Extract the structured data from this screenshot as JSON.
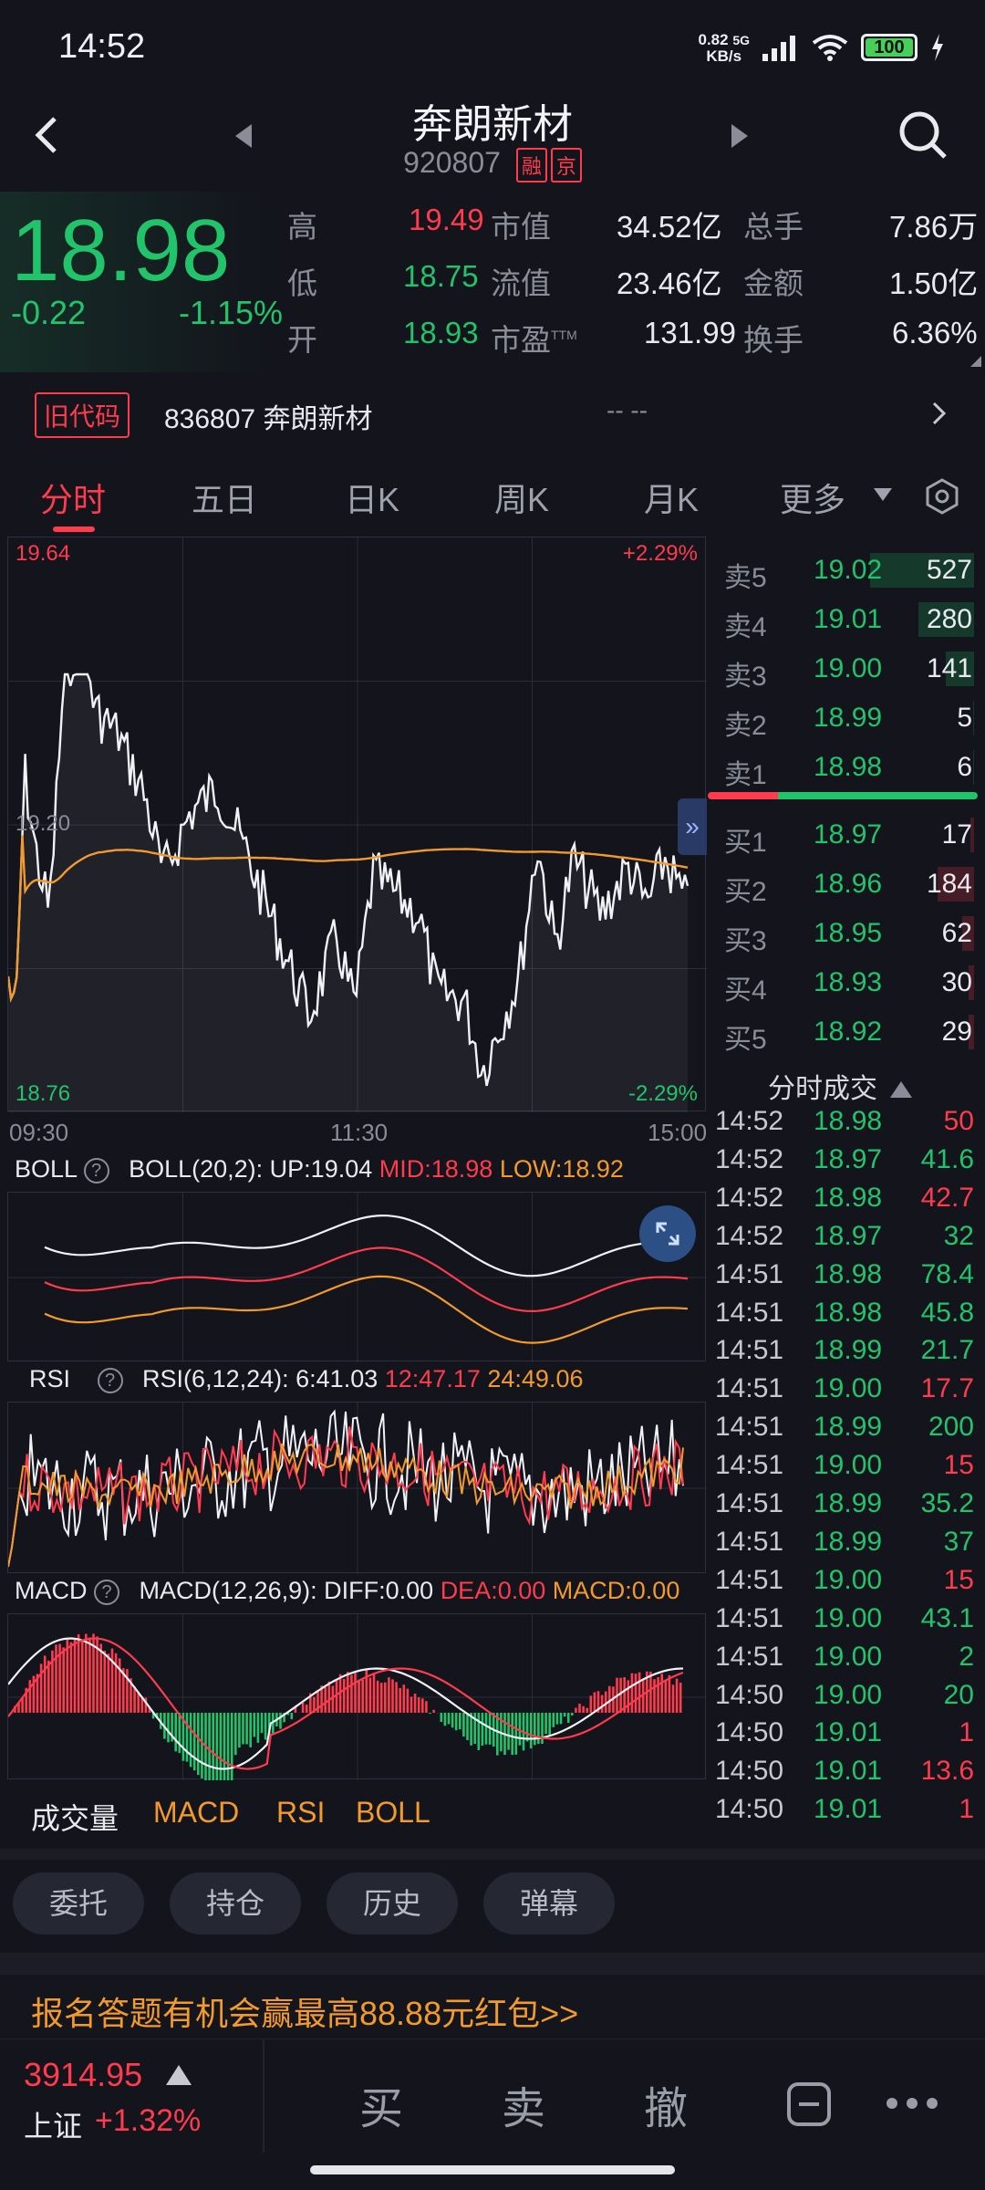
{
  "status": {
    "time": "14:52",
    "netspeed_value": "0.82",
    "netspeed_unit": "KB/s",
    "network": "5G",
    "battery": "100"
  },
  "header": {
    "title": "奔朗新材",
    "code": "920807",
    "tag1": "融",
    "tag2": "京"
  },
  "quote": {
    "price": "18.98",
    "change": "-0.22",
    "change_pct": "-1.15%",
    "high_label": "高",
    "high": "19.49",
    "low_label": "低",
    "low": "18.75",
    "open_label": "开",
    "open": "18.93",
    "mktcap_label": "市值",
    "mktcap": "34.52亿",
    "float_label": "流值",
    "float": "23.46亿",
    "pe_label": "市盈",
    "pe_sup": "TTM",
    "pe": "131.99",
    "vol_label": "总手",
    "vol": "7.86万",
    "amt_label": "金额",
    "amt": "1.50亿",
    "turn_label": "换手",
    "turn": "6.36%"
  },
  "oldcode": {
    "badge": "旧代码",
    "text": "836807 奔朗新材",
    "placeholder": "-- --"
  },
  "tabs": [
    "分时",
    "五日",
    "日K",
    "周K",
    "月K",
    "更多"
  ],
  "intraday": {
    "y_top": "19.64",
    "y_mid": "19.20",
    "y_bot": "18.76",
    "pct_top": "+2.29%",
    "pct_bot": "-2.29%",
    "time_start": "09:30",
    "time_mid": "11:30",
    "time_end": "15:00"
  },
  "boll": {
    "label": "BOLL",
    "params": "BOLL(20,2):",
    "up": "UP:19.04",
    "mid": "MID:18.98",
    "low": "LOW:18.92"
  },
  "rsi": {
    "label": "RSI",
    "params": "RSI(6,12,24):",
    "r6": "6:41.03",
    "r12": "12:47.17",
    "r24": "24:49.06"
  },
  "macd": {
    "label": "MACD",
    "params": "MACD(12,26,9):",
    "diff": "DIFF:0.00",
    "dea": "DEA:0.00",
    "macd": "MACD:0.00"
  },
  "indicator_tabs": [
    "成交量",
    "MACD",
    "RSI",
    "BOLL"
  ],
  "orderbook": {
    "asks": [
      {
        "label": "卖5",
        "price": "19.02",
        "vol": "527"
      },
      {
        "label": "卖4",
        "price": "19.01",
        "vol": "280"
      },
      {
        "label": "卖3",
        "price": "19.00",
        "vol": "141"
      },
      {
        "label": "卖2",
        "price": "18.99",
        "vol": "5"
      },
      {
        "label": "卖1",
        "price": "18.98",
        "vol": "6"
      }
    ],
    "bids": [
      {
        "label": "买1",
        "price": "18.97",
        "vol": "17"
      },
      {
        "label": "买2",
        "price": "18.96",
        "vol": "184"
      },
      {
        "label": "买3",
        "price": "18.95",
        "vol": "62"
      },
      {
        "label": "买4",
        "price": "18.93",
        "vol": "30"
      },
      {
        "label": "买5",
        "price": "18.92",
        "vol": "29"
      }
    ]
  },
  "ticks_title": "分时成交",
  "ticks": [
    {
      "t": "14:52",
      "p": "18.98",
      "v": "50",
      "vc": "red"
    },
    {
      "t": "14:52",
      "p": "18.97",
      "v": "41.6",
      "vc": "green"
    },
    {
      "t": "14:52",
      "p": "18.98",
      "v": "42.7",
      "vc": "red"
    },
    {
      "t": "14:52",
      "p": "18.97",
      "v": "32",
      "vc": "green"
    },
    {
      "t": "14:51",
      "p": "18.98",
      "v": "78.4",
      "vc": "green"
    },
    {
      "t": "14:51",
      "p": "18.98",
      "v": "45.8",
      "vc": "green"
    },
    {
      "t": "14:51",
      "p": "18.99",
      "v": "21.7",
      "vc": "green"
    },
    {
      "t": "14:51",
      "p": "19.00",
      "v": "17.7",
      "vc": "red"
    },
    {
      "t": "14:51",
      "p": "18.99",
      "v": "200",
      "vc": "green"
    },
    {
      "t": "14:51",
      "p": "19.00",
      "v": "15",
      "vc": "red"
    },
    {
      "t": "14:51",
      "p": "18.99",
      "v": "35.2",
      "vc": "green"
    },
    {
      "t": "14:51",
      "p": "18.99",
      "v": "37",
      "vc": "green"
    },
    {
      "t": "14:51",
      "p": "19.00",
      "v": "15",
      "vc": "red"
    },
    {
      "t": "14:51",
      "p": "19.00",
      "v": "43.1",
      "vc": "green"
    },
    {
      "t": "14:51",
      "p": "19.00",
      "v": "2",
      "vc": "green"
    },
    {
      "t": "14:50",
      "p": "19.00",
      "v": "20",
      "vc": "green"
    },
    {
      "t": "14:50",
      "p": "19.01",
      "v": "1",
      "vc": "red"
    },
    {
      "t": "14:50",
      "p": "19.01",
      "v": "13.6",
      "vc": "red"
    },
    {
      "t": "14:50",
      "p": "19.01",
      "v": "1",
      "vc": "red"
    }
  ],
  "pills": [
    "委托",
    "持仓",
    "历史",
    "弹幕"
  ],
  "promo": "报名答题有机会赢最高88.88元红包>>",
  "index": {
    "value": "3914.95",
    "name": "上证",
    "change": "+1.32%"
  },
  "actions": {
    "buy": "买",
    "sell": "卖",
    "cancel": "撤"
  },
  "colors": {
    "up": "#ff3b4d",
    "down": "#22c46b",
    "avg": "#f29a2e",
    "bg": "#13141c"
  }
}
